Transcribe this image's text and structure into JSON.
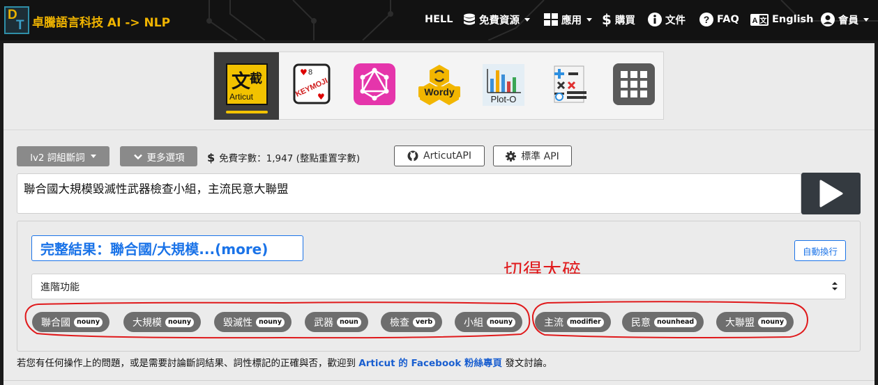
{
  "nav": {
    "brand": "卓騰語言科技 AI -> NLP",
    "items": [
      {
        "label": "HELL",
        "icon": "",
        "dropdown": false
      },
      {
        "label": "免費資源",
        "icon": "database-icon",
        "dropdown": true
      },
      {
        "label": "應用",
        "icon": "grid-icon",
        "dropdown": true
      },
      {
        "label": "購買",
        "icon": "dollar-icon",
        "dropdown": false
      },
      {
        "label": "文件",
        "icon": "info-icon",
        "dropdown": false
      },
      {
        "label": "FAQ",
        "icon": "question-icon",
        "dropdown": false
      },
      {
        "label": "English",
        "icon": "language-icon",
        "dropdown": false
      },
      {
        "label": "會員",
        "icon": "user-icon",
        "dropdown": true
      }
    ]
  },
  "tools": [
    {
      "name": "Articut",
      "glyph": "文",
      "glyph2": "截",
      "active": true
    },
    {
      "name": "KEYMOJI",
      "glyph": "KEYMOJI"
    },
    {
      "name": "GraphQL",
      "glyph": ""
    },
    {
      "name": "Wordy",
      "glyph": "Wordy"
    },
    {
      "name": "Plot-O",
      "glyph": "Plot-O"
    },
    {
      "name": "Calculator",
      "glyph": ""
    },
    {
      "name": "More apps",
      "glyph": ""
    }
  ],
  "controls": {
    "level_label": "lv2 詞組斷詞",
    "more_options_label": "更多選項",
    "credit_text": "免費字數：1,947 (整點重置字數)",
    "github_label": "ArticutAPI",
    "standard_api_label": "標準 API"
  },
  "input": {
    "text": "聯合國大規模毀滅性武器檢查小組，主流民意大聯盟"
  },
  "result": {
    "title": "完整結果：聯合國/大規模...(more)",
    "wrap_label": "自動換行",
    "advanced_label": "進階功能",
    "annotation": "切得太碎",
    "tokens": [
      {
        "word": "聯合國",
        "pos": "nouny"
      },
      {
        "word": "大規模",
        "pos": "nouny"
      },
      {
        "word": "毀滅性",
        "pos": "nouny"
      },
      {
        "word": "武器",
        "pos": "noun"
      },
      {
        "word": "檢查",
        "pos": "verb"
      },
      {
        "word": "小組",
        "pos": "nouny"
      },
      {
        "word": "主流",
        "pos": "modifier"
      },
      {
        "word": "民意",
        "pos": "nounhead"
      },
      {
        "word": "大聯盟",
        "pos": "nouny"
      }
    ]
  },
  "footer": {
    "prefix": "若您有任何操作上的問題，或是需要討論斷詞結果、詞性標記的正確與否，歡迎到",
    "link": "Articut 的 Facebook 粉絲專頁",
    "suffix": "發文討論。"
  },
  "colors": {
    "brand": "#f0b400",
    "link_blue": "#1a73e8",
    "annotation_red": "#e0191b",
    "token_gray": "#6e6e6e"
  }
}
